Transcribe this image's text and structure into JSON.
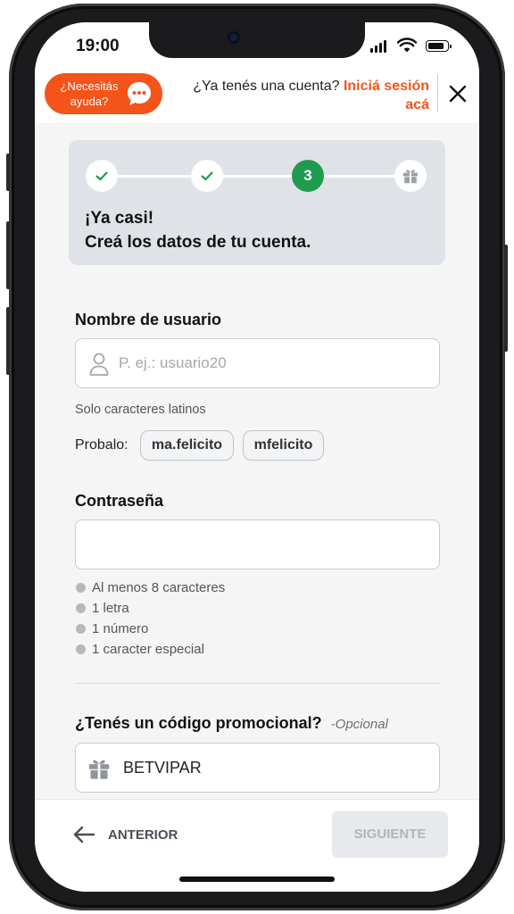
{
  "status_bar": {
    "time": "19:00"
  },
  "header": {
    "help_button_label": "¿Necesitás ayuda?",
    "login_prompt": "¿Ya tenés una cuenta?",
    "login_link": "Iniciá sesión acá"
  },
  "progress": {
    "current_step": "3",
    "title_line1": "¡Ya casi!",
    "title_line2": "Creá los datos de tu cuenta."
  },
  "username": {
    "label": "Nombre de usuario",
    "placeholder": "P. ej.: usuario20",
    "hint": "Solo caracteres latinos",
    "suggest_label": "Probalo:",
    "suggestions": [
      "ma.felicito",
      "mfelicito"
    ]
  },
  "password": {
    "label": "Contraseña",
    "requirements": [
      "Al menos 8 caracteres",
      "1 letra",
      "1 número",
      "1 caracter especial"
    ]
  },
  "promo": {
    "label": "¿Tenés un código promocional?",
    "optional_label": "-Opcional",
    "value": "BETVIPAR"
  },
  "footer": {
    "back_label": "ANTERIOR",
    "next_label": "SIGUIENTE"
  },
  "colors": {
    "accent": "#f4541a",
    "step_active": "#1f9a4f",
    "card_bg": "#dfe3e8"
  }
}
